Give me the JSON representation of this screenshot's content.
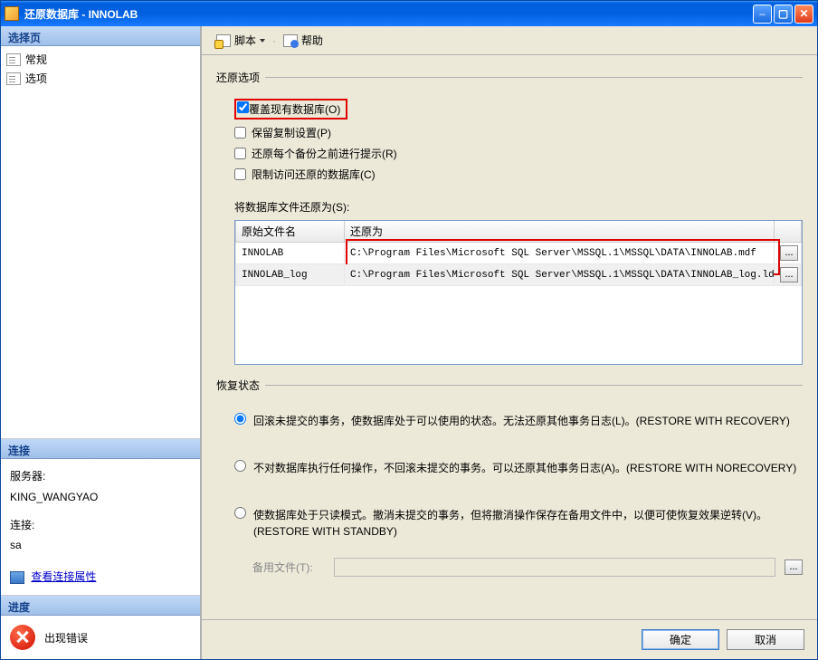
{
  "window": {
    "title": "还原数据库 - INNOLAB"
  },
  "sidebar": {
    "pages_header": "选择页",
    "pages": [
      "常规",
      "选项"
    ],
    "conn_header": "连接",
    "server_label": "服务器:",
    "server_value": "KING_WANGYAO",
    "conn_label": "连接:",
    "conn_value": "sa",
    "view_conn": "查看连接属性",
    "progress_header": "进度",
    "error_text": "出现错误"
  },
  "toolbar": {
    "script": "脚本",
    "help": "帮助"
  },
  "restore_options": {
    "group": "还原选项",
    "overwrite": "覆盖现有数据库(O)",
    "preserve": "保留复制设置(P)",
    "prompt": "还原每个备份之前进行提示(R)",
    "restrict": "限制访问还原的数据库(C)",
    "files_label": "将数据库文件还原为(S):",
    "col_orig": "原始文件名",
    "col_restore": "还原为",
    "rows": [
      {
        "name": "INNOLAB",
        "path": "C:\\Program Files\\Microsoft SQL Server\\MSSQL.1\\MSSQL\\DATA\\INNOLAB.mdf"
      },
      {
        "name": "INNOLAB_log",
        "path": "C:\\Program Files\\Microsoft SQL Server\\MSSQL.1\\MSSQL\\DATA\\INNOLAB_log.ldf"
      }
    ]
  },
  "recovery": {
    "group": "恢复状态",
    "r1": "回滚未提交的事务，使数据库处于可以使用的状态。无法还原其他事务日志(L)。(RESTORE WITH RECOVERY)",
    "r2": "不对数据库执行任何操作，不回滚未提交的事务。可以还原其他事务日志(A)。(RESTORE WITH NORECOVERY)",
    "r3": "使数据库处于只读模式。撤消未提交的事务，但将撤消操作保存在备用文件中，以便可使恢复效果逆转(V)。(RESTORE WITH STANDBY)",
    "standby_label": "备用文件(T):"
  },
  "buttons": {
    "ok": "确定",
    "cancel": "取消"
  },
  "misc": {
    "ellipsis": "..."
  }
}
